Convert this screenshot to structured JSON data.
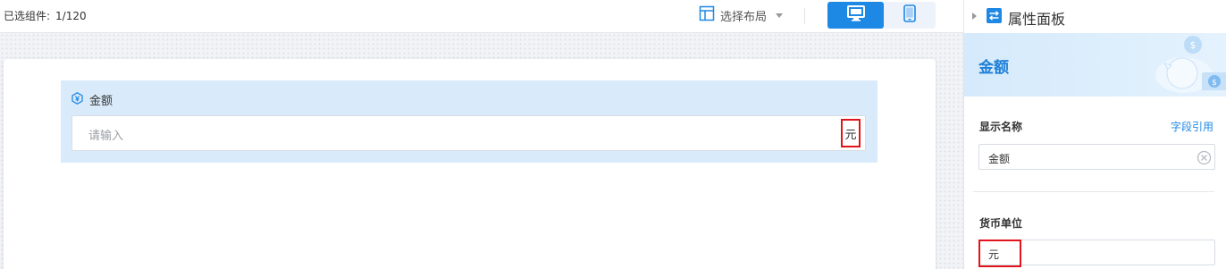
{
  "toolbar": {
    "selected_label": "已选组件:",
    "selected_count": "1/120",
    "layout_picker_label": "选择布局"
  },
  "form": {
    "field_label": "金额",
    "amount_placeholder": "请输入",
    "unit_suffix": "元"
  },
  "panel": {
    "title": "属性面板",
    "banner_title": "金额",
    "display_name_label": "显示名称",
    "field_ref_link": "字段引用",
    "display_name_value": "金额",
    "currency_unit_label": "货币单位",
    "currency_unit_value": "元"
  },
  "colors": {
    "accent": "#1e88e5",
    "highlight_border": "#e0141a",
    "field_block_bg": "#d9ebfb"
  },
  "icons": [
    "layout-icon",
    "desktop-icon",
    "mobile-icon",
    "currency-field-icon",
    "panel-settings-icon",
    "piggy-bank-illustration",
    "clear-icon"
  ]
}
